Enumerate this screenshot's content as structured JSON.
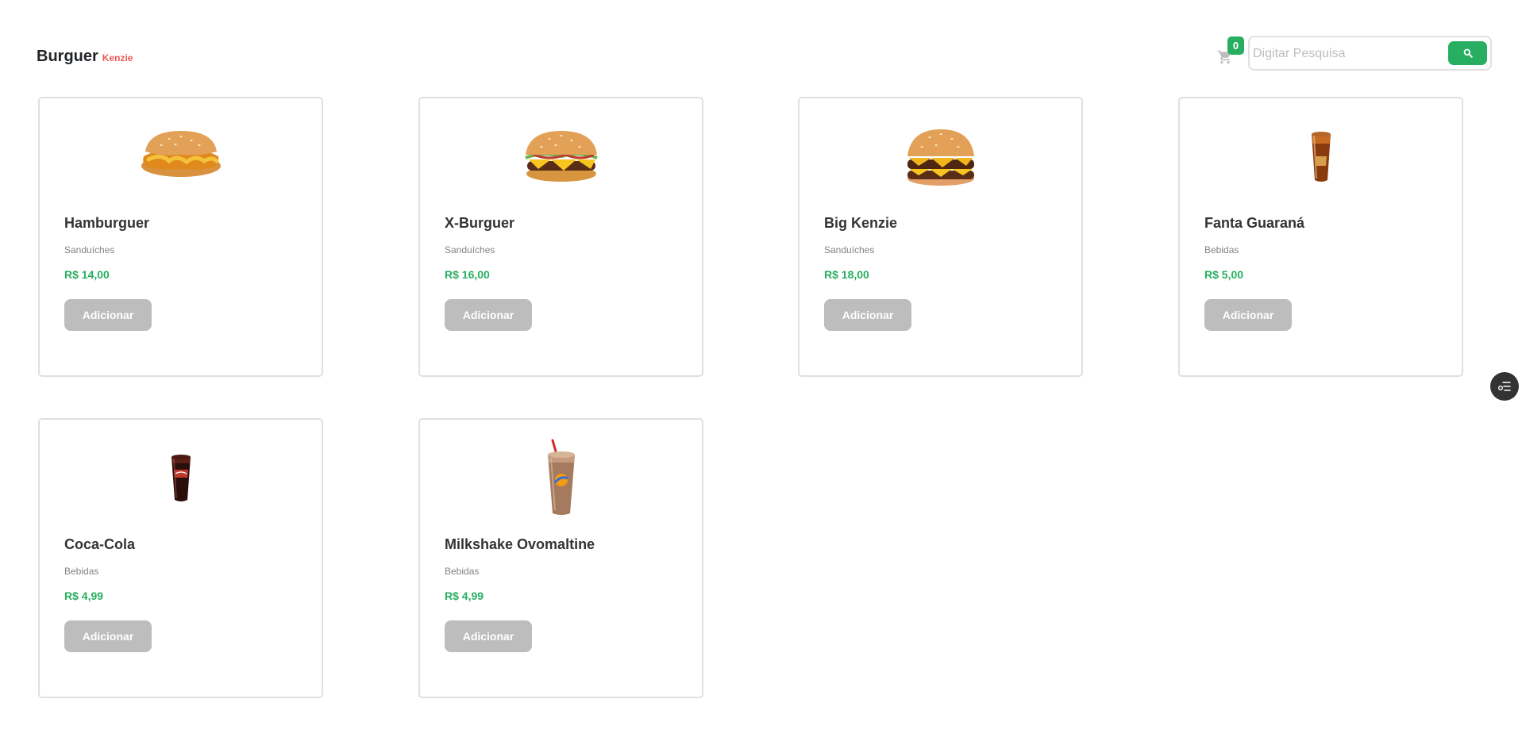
{
  "header": {
    "brand_main": "Burguer",
    "brand_sub": "Kenzie",
    "cart_count": "0",
    "search_placeholder": "Digitar Pesquisa",
    "search_value": ""
  },
  "colors": {
    "primary": "#27ae60",
    "brand_secondary": "#eb5757",
    "button_disabled": "#bdbdbd"
  },
  "products": [
    {
      "name": "Hamburguer",
      "category": "Sanduíches",
      "price": "R$ 14,00",
      "button": "Adicionar",
      "image": "chicken-burger-image"
    },
    {
      "name": "X-Burguer",
      "category": "Sanduíches",
      "price": "R$ 16,00",
      "button": "Adicionar",
      "image": "cheeseburger-image"
    },
    {
      "name": "Big Kenzie",
      "category": "Sanduíches",
      "price": "R$ 18,00",
      "button": "Adicionar",
      "image": "double-burger-image"
    },
    {
      "name": "Fanta Guaraná",
      "category": "Bebidas",
      "price": "R$ 5,00",
      "button": "Adicionar",
      "image": "soda-cup-image"
    },
    {
      "name": "Coca-Cola",
      "category": "Bebidas",
      "price": "R$ 4,99",
      "button": "Adicionar",
      "image": "cola-cup-image"
    },
    {
      "name": "Milkshake Ovomaltine",
      "category": "Bebidas",
      "price": "R$ 4,99",
      "button": "Adicionar",
      "image": "milkshake-image"
    }
  ]
}
